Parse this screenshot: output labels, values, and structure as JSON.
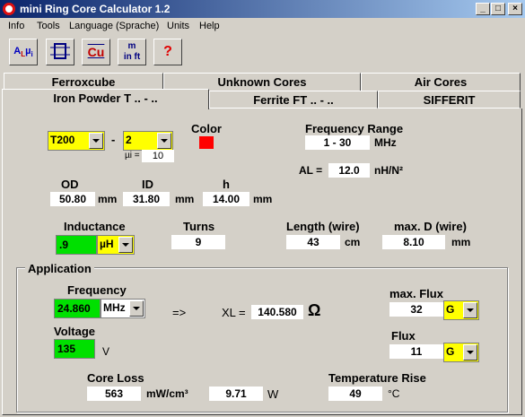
{
  "window": {
    "title": "mini Ring Core Calculator 1.2"
  },
  "menu": [
    "Info",
    "Tools",
    "Language (Sprache)",
    "Units",
    "Help"
  ],
  "toolbar": [
    {
      "name": "al-mu-button",
      "label": "A L µi"
    },
    {
      "name": "winding-button",
      "label": ""
    },
    {
      "name": "copper-button",
      "label": "Cu"
    },
    {
      "name": "units-button",
      "label": "m in ft"
    },
    {
      "name": "help-button",
      "label": "?"
    }
  ],
  "tabs": {
    "row1": [
      "Ferroxcube",
      "Unknown Cores",
      "Air Cores"
    ],
    "row2": [
      "Iron Powder T .. - ..",
      "Ferrite FT .. - ..",
      "SIFFERIT"
    ]
  },
  "core": {
    "type": "T200",
    "separator": "-",
    "mix": "2",
    "mu_label": "µi =",
    "mu": "10",
    "color_label": "Color",
    "color": "#ff0000"
  },
  "frequency_range": {
    "label": "Frequency Range",
    "value": "1 - 30",
    "unit": "MHz"
  },
  "al": {
    "label": "AL =",
    "value": "12.0",
    "unit": "nH/N²"
  },
  "dims": {
    "od_label": "OD",
    "od": "50.80",
    "od_unit": "mm",
    "id_label": "ID",
    "id": "31.80",
    "id_unit": "mm",
    "h_label": "h",
    "h": "14.00",
    "h_unit": "mm"
  },
  "inductance": {
    "label": "Inductance",
    "value": ".9",
    "unit": "µH"
  },
  "turns": {
    "label": "Turns",
    "value": "9"
  },
  "wire_length": {
    "label": "Length (wire)",
    "value": "43",
    "unit": "cm"
  },
  "wire_d": {
    "label": "max. D (wire)",
    "value": "8.10",
    "unit": "mm"
  },
  "application": {
    "label": "Application",
    "frequency_label": "Frequency",
    "frequency": "24.860",
    "frequency_unit": "MHz",
    "arrow": "=>",
    "xl_label": "XL =",
    "xl": "140.580",
    "xl_unit": "Ω",
    "voltage_label": "Voltage",
    "voltage": "135",
    "voltage_unit": "V",
    "max_flux_label": "max. Flux",
    "max_flux": "32",
    "max_flux_unit": "G",
    "flux_label": "Flux",
    "flux": "11",
    "flux_unit": "G",
    "core_loss_label": "Core Loss",
    "core_loss": "563",
    "core_loss_unit": "mW/cm³",
    "power": "9.71",
    "power_unit": "W",
    "temp_label": "Temperature Rise",
    "temp": "49",
    "temp_unit": "°C"
  }
}
